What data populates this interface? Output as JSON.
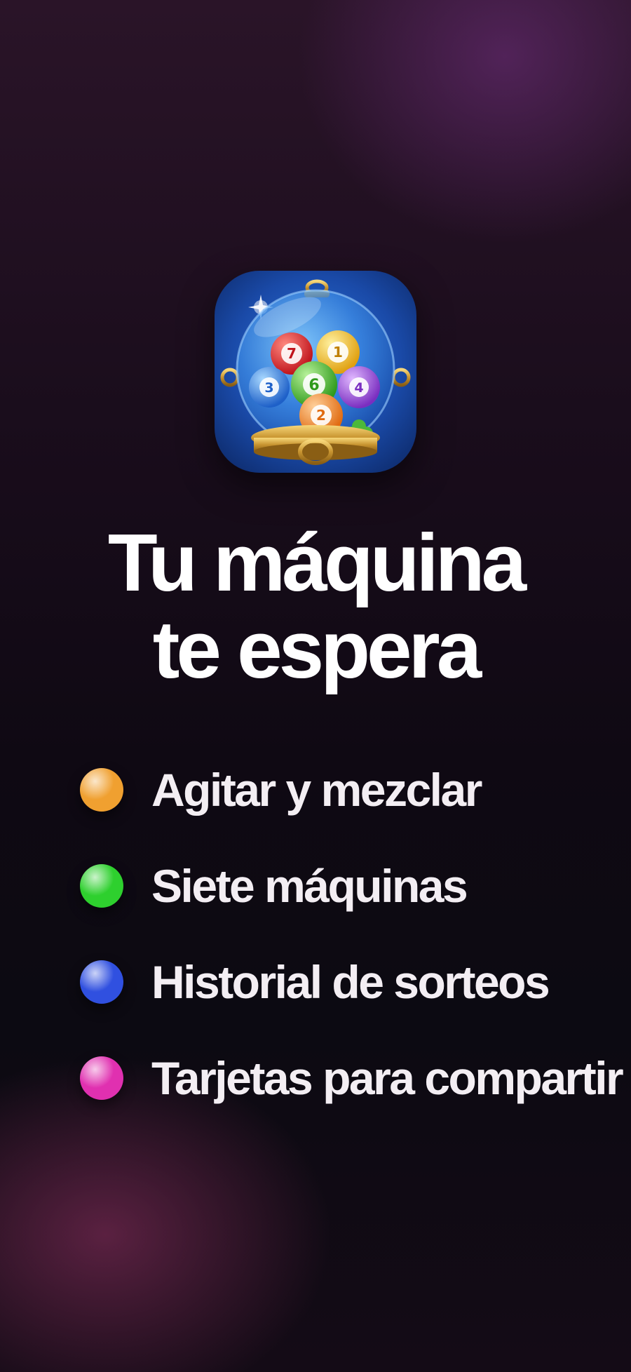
{
  "app_icon": {
    "name": "lottery-globe-icon"
  },
  "headline": {
    "line1": "Tu máquina",
    "line2": "te espera"
  },
  "features": [
    {
      "label": "Agitar y mezclar",
      "dot_color": "#f0a030"
    },
    {
      "label": "Siete máquinas",
      "dot_color": "#2ed02e"
    },
    {
      "label": "Historial de sorteos",
      "dot_color": "#3050e0"
    },
    {
      "label": "Tarjetas para compartir",
      "dot_color": "#e030b0"
    }
  ],
  "colors": {
    "text": "#ffffff",
    "icon_background": "#1a4fb0",
    "accent_gold": "#d4a63a"
  }
}
